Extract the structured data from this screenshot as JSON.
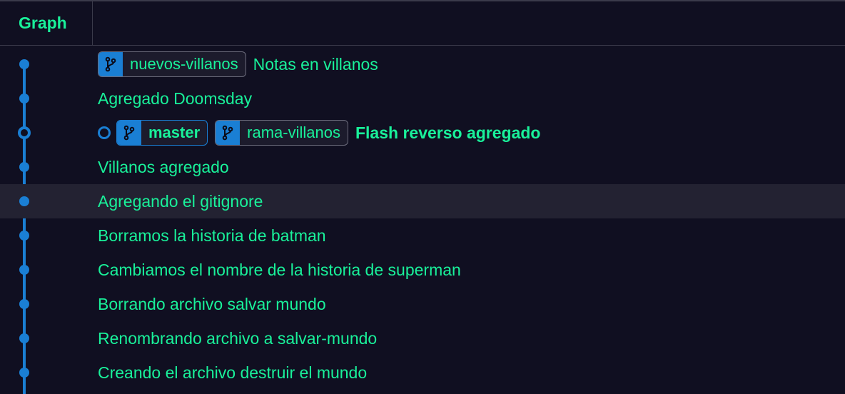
{
  "header": {
    "graph_label": "Graph"
  },
  "commits": [
    {
      "message": "Notas en villanos",
      "branches": [
        "nuevos-villanos"
      ],
      "head": false
    },
    {
      "message": "Agregado Doomsday",
      "branches": [],
      "head": false
    },
    {
      "message": "Flash reverso agregado",
      "branches": [
        "master",
        "rama-villanos"
      ],
      "head": true
    },
    {
      "message": "Villanos agregado",
      "branches": [],
      "head": false
    },
    {
      "message": "Agregando el gitignore",
      "branches": [],
      "head": false
    },
    {
      "message": "Borramos la historia de batman",
      "branches": [],
      "head": false
    },
    {
      "message": "Cambiamos el nombre de la historia de superman",
      "branches": [],
      "head": false
    },
    {
      "message": "Borrando archivo salvar mundo",
      "branches": [],
      "head": false
    },
    {
      "message": "Renombrando archivo a salvar-mundo",
      "branches": [],
      "head": false
    },
    {
      "message": "Creando el archivo destruir el mundo",
      "branches": [],
      "head": false
    }
  ],
  "colors": {
    "background": "#100f21",
    "accent_text": "#19f19a",
    "graph_blue": "#1a7fd4",
    "selected_row": "#232232"
  },
  "icons": {
    "branch": "git-branch-icon",
    "commit": "commit-node-icon"
  }
}
